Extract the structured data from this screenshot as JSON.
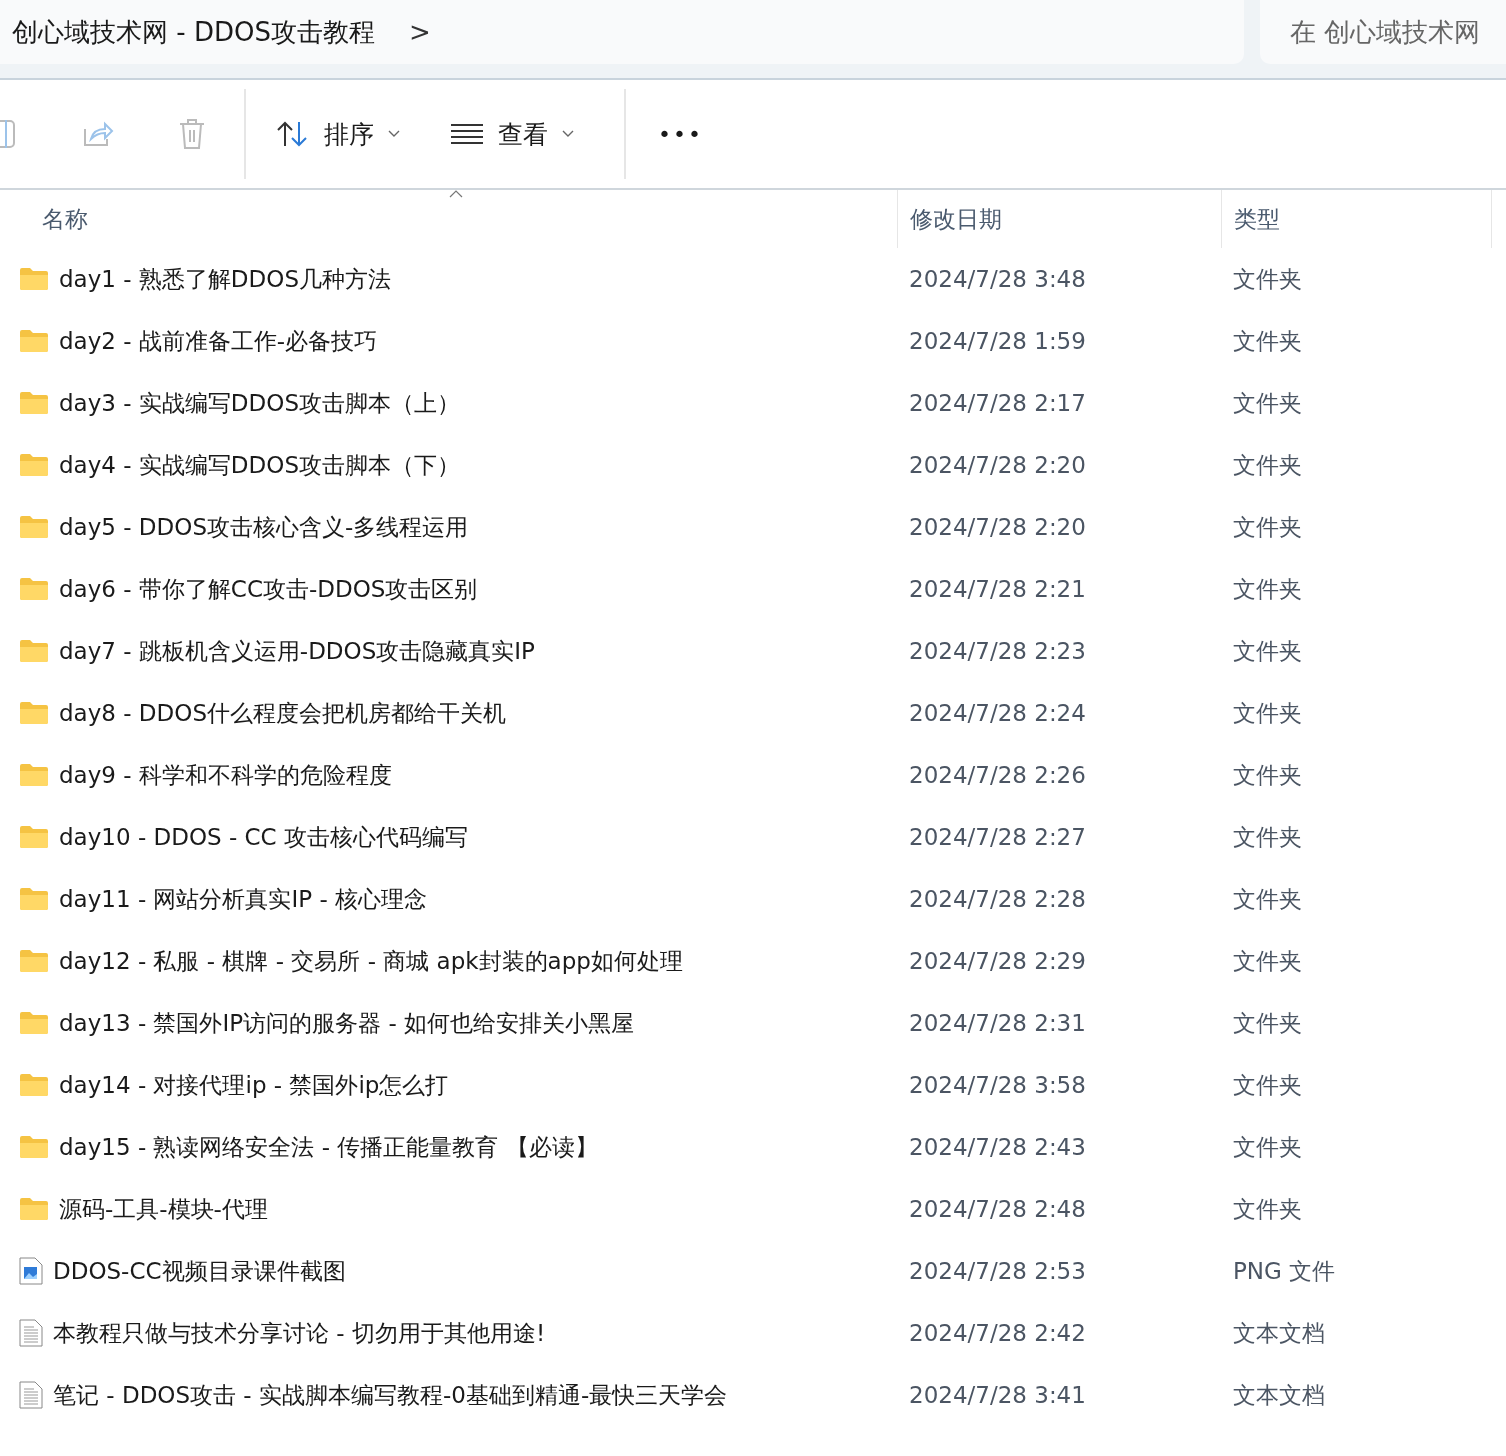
{
  "address_bar": {
    "path": "创心域技术网 - DDOS攻击教程",
    "chevron": ">"
  },
  "search": {
    "placeholder": "在 创心域技术网"
  },
  "toolbar": {
    "sort_label": "排序",
    "view_label": "查看",
    "more": "•••"
  },
  "table": {
    "columns": [
      {
        "label": "名称",
        "sorted": true
      },
      {
        "label": "修改日期",
        "sorted": false
      },
      {
        "label": "类型",
        "sorted": false
      }
    ],
    "rows": [
      {
        "kind": "folder",
        "name": "day1 - 熟悉了解DDOS几种方法",
        "date": "2024/7/28 3:48",
        "type": "文件夹"
      },
      {
        "kind": "folder",
        "name": "day2 - 战前准备工作-必备技巧",
        "date": "2024/7/28 1:59",
        "type": "文件夹"
      },
      {
        "kind": "folder",
        "name": "day3 - 实战编写DDOS攻击脚本（上）",
        "date": "2024/7/28 2:17",
        "type": "文件夹"
      },
      {
        "kind": "folder",
        "name": "day4 - 实战编写DDOS攻击脚本（下）",
        "date": "2024/7/28 2:20",
        "type": "文件夹"
      },
      {
        "kind": "folder",
        "name": "day5 - DDOS攻击核心含义-多线程运用",
        "date": "2024/7/28 2:20",
        "type": "文件夹"
      },
      {
        "kind": "folder",
        "name": "day6 - 带你了解CC攻击-DDOS攻击区别",
        "date": "2024/7/28 2:21",
        "type": "文件夹"
      },
      {
        "kind": "folder",
        "name": "day7 - 跳板机含义运用-DDOS攻击隐藏真实IP",
        "date": "2024/7/28 2:23",
        "type": "文件夹"
      },
      {
        "kind": "folder",
        "name": "day8 - DDOS什么程度会把机房都给干关机",
        "date": "2024/7/28 2:24",
        "type": "文件夹"
      },
      {
        "kind": "folder",
        "name": "day9 - 科学和不科学的危险程度",
        "date": "2024/7/28 2:26",
        "type": "文件夹"
      },
      {
        "kind": "folder",
        "name": "day10 - DDOS - CC 攻击核心代码编写",
        "date": "2024/7/28 2:27",
        "type": "文件夹"
      },
      {
        "kind": "folder",
        "name": "day11 - 网站分析真实IP - 核心理念",
        "date": "2024/7/28 2:28",
        "type": "文件夹"
      },
      {
        "kind": "folder",
        "name": "day12 - 私服 - 棋牌 - 交易所 - 商城 apk封装的app如何处理",
        "date": "2024/7/28 2:29",
        "type": "文件夹"
      },
      {
        "kind": "folder",
        "name": "day13 - 禁国外IP访问的服务器 - 如何也给安排关小黑屋",
        "date": "2024/7/28 2:31",
        "type": "文件夹"
      },
      {
        "kind": "folder",
        "name": "day14 - 对接代理ip - 禁国外ip怎么打",
        "date": "2024/7/28 3:58",
        "type": "文件夹"
      },
      {
        "kind": "folder",
        "name": "day15 - 熟读网络安全法 - 传播正能量教育 【必读】",
        "date": "2024/7/28 2:43",
        "type": "文件夹"
      },
      {
        "kind": "folder",
        "name": "源码-工具-模块-代理",
        "date": "2024/7/28 2:48",
        "type": "文件夹"
      },
      {
        "kind": "image",
        "name": "DDOS-CC视频目录课件截图",
        "date": "2024/7/28 2:53",
        "type": "PNG 文件"
      },
      {
        "kind": "text",
        "name": "本教程只做与技术分享讨论 - 切勿用于其他用途!",
        "date": "2024/7/28 2:42",
        "type": "文本文档"
      },
      {
        "kind": "text",
        "name": "笔记 - DDOS攻击 - 实战脚本编写教程-0基础到精通-最快三天学会",
        "date": "2024/7/28 3:41",
        "type": "文本文档"
      }
    ]
  }
}
